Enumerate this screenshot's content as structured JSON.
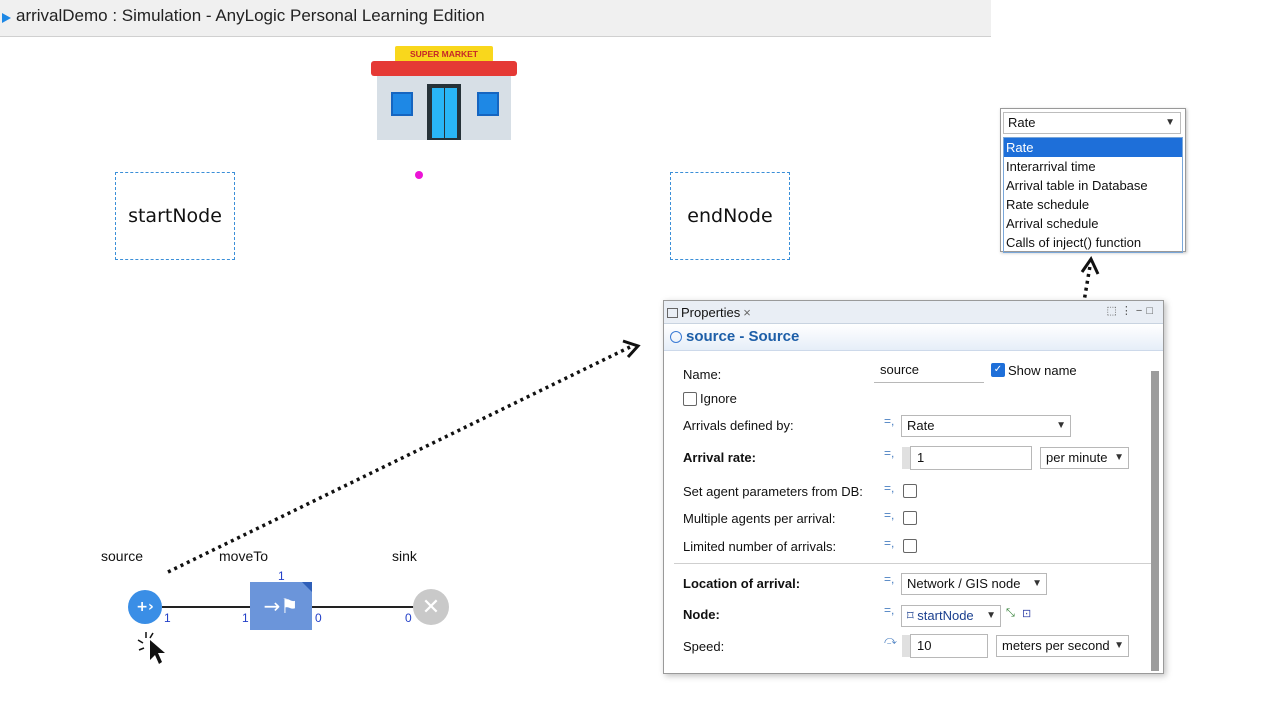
{
  "window": {
    "title": "arrivalDemo : Simulation - AnyLogic Personal Learning Edition"
  },
  "canvas": {
    "store": {
      "sign": "SUPER MARKET"
    },
    "nodes": {
      "start": "startNode",
      "end": "endNode"
    },
    "flowchart": {
      "source_label": "source",
      "moveto_label": "moveTo",
      "sink_label": "sink",
      "source_out": "1",
      "moveto_top": "1",
      "moveto_in": "1",
      "moveto_out": "0",
      "sink_in": "0"
    }
  },
  "dropdown": {
    "current": "Rate",
    "options": [
      "Rate",
      "Interarrival time",
      "Arrival table in Database",
      "Rate schedule",
      "Arrival schedule",
      "Calls of inject() function"
    ],
    "selected_index": 0
  },
  "properties": {
    "tab": "Properties",
    "header": "source - Source",
    "name_label": "Name:",
    "name_value": "source",
    "show_name_label": "Show name",
    "ignore_label": "Ignore",
    "arrivals_label": "Arrivals defined by:",
    "arrivals_value": "Rate",
    "rate_label": "Arrival rate:",
    "rate_value": "1",
    "rate_unit": "per minute",
    "db_label": "Set agent parameters from DB:",
    "multiple_label": "Multiple agents per arrival:",
    "limited_label": "Limited number of arrivals:",
    "location_label": "Location of arrival:",
    "location_value": "Network / GIS node",
    "node_label": "Node:",
    "node_value": "startNode",
    "speed_label": "Speed:",
    "speed_value": "10",
    "speed_unit": "meters per second"
  },
  "colors": {
    "accent": "#1e6fd9",
    "node_border": "#3b8fd8",
    "port_number": "#2340c8",
    "cursor_dot": "#ec14d6"
  }
}
